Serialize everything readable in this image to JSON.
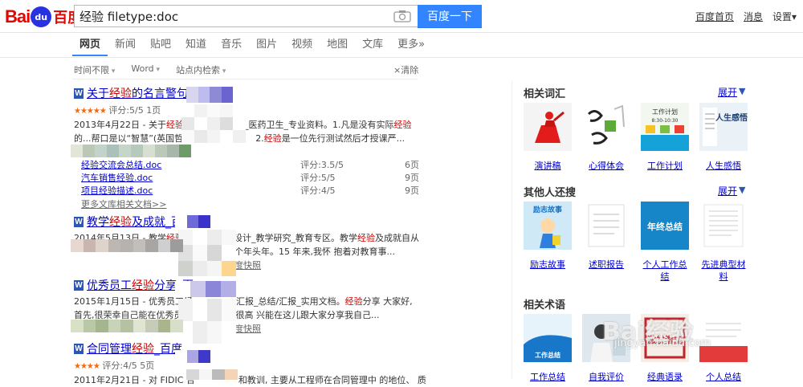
{
  "header": {
    "logo_text_1": "Bai",
    "logo_paw": "du",
    "logo_text_2": "百度",
    "search_value": "经验 filetype:doc",
    "search_button": "百度一下",
    "toplinks": [
      "百度首页",
      "消息",
      "设置▾"
    ]
  },
  "tabs": [
    {
      "label": "网页",
      "active": true
    },
    {
      "label": "新闻"
    },
    {
      "label": "贴吧"
    },
    {
      "label": "知道"
    },
    {
      "label": "音乐"
    },
    {
      "label": "图片"
    },
    {
      "label": "视频"
    },
    {
      "label": "地图"
    },
    {
      "label": "文库"
    },
    {
      "label": "更多»"
    }
  ],
  "filters": {
    "items": [
      "时间不限",
      "Word",
      "站点内检索"
    ],
    "clear": "×清除"
  },
  "results": [
    {
      "title_pre": "关于",
      "title_em": "经验",
      "title_post": "的名言警句",
      "stars": "★★★★★",
      "rating": "评分:5/5 1页",
      "snippet1_date": "2013年4月22日 - 关于",
      "snippet1_em": "经验",
      "snippet1_tail": "学_医药卫生_专业资料。1.凡是没有实际",
      "snippet1_em2": "经验",
      "snippet2_pre": "的...帮口是以“智慧”(英国哲",
      "snippet2_tail": "2.",
      "snippet2_em": "经验",
      "snippet2_tail2": "是一位先行测试然后才授课严...",
      "subdocs": [
        {
          "name": "经验交流会总结.doc",
          "score": "评分:3.5/5",
          "pages": "6页"
        },
        {
          "name": "汽车销售经验.doc",
          "score": "评分:5/5",
          "pages": "9页"
        },
        {
          "name": "项目经验描述.doc",
          "score": "评分:4/5",
          "pages": "9页"
        }
      ],
      "more": "更多文库相关文档>>"
    },
    {
      "title_pre": "教学",
      "title_em": "经验",
      "title_post": "及成就_百度",
      "meta_date": "2014年5月13日 - 教学",
      "meta_em": "经验",
      "meta_tail": "设计_教学研究_教育专区。教学",
      "meta_em2": "经验",
      "meta_tail2": "及成就自从",
      "snippet2": "年。15 年来,我怀 抱着对教育事...",
      "snippet2_pre": "个年头",
      "snap": "度快照"
    },
    {
      "title_pre": "优秀员工",
      "title_em": "经验",
      "title_post": "分享_百",
      "meta_date": "2015年1月15日 - 优秀员工经",
      "meta_tail": "汇报_总结/汇报_实用文档。",
      "meta_em": "经验",
      "meta_tail2": "分享 大家好,",
      "snippet2": "首先,很荣幸自己能在优秀员",
      "snippet2_tail": "在很高 兴能在这儿跟大家分享我自己...",
      "snap": "度快照"
    },
    {
      "title_pre": "合同管理",
      "title_em": "经验",
      "title_post": "_百度",
      "stars": "★★★★",
      "rating": "评分:4/5 5页",
      "meta_date": "2011年2月21日 - 对 FIDIC 合",
      "meta_tail": "和教训, 主要从工程师在合同管理中 的地位、 质"
    }
  ],
  "right": {
    "section1": {
      "title": "相关词汇",
      "more": "展开"
    },
    "tiles1": [
      "演讲稿",
      "心得体会",
      "工作计划",
      "人生感悟"
    ],
    "section2": {
      "title": "其他人还搜",
      "more": "展开"
    },
    "tiles2": [
      "励志故事",
      "述职报告",
      "个人工作总结",
      "先进典型材料"
    ],
    "section3": {
      "title": "相关术语"
    },
    "tiles3": [
      "工作总结",
      "自我评价",
      "经典语录",
      "个人总结"
    ],
    "thumb_text": {
      "t1_3": "工作计划",
      "t1_3b": "8:30-10:30",
      "t1_4": "人生感悟",
      "t2_1": "励志故事",
      "t2_3": "年终总结",
      "t3_1": "工作总结",
      "t3_3": "激发潜能"
    },
    "watermark": "Bai经验",
    "watermark_sub": "jingyan.baidu.com"
  }
}
